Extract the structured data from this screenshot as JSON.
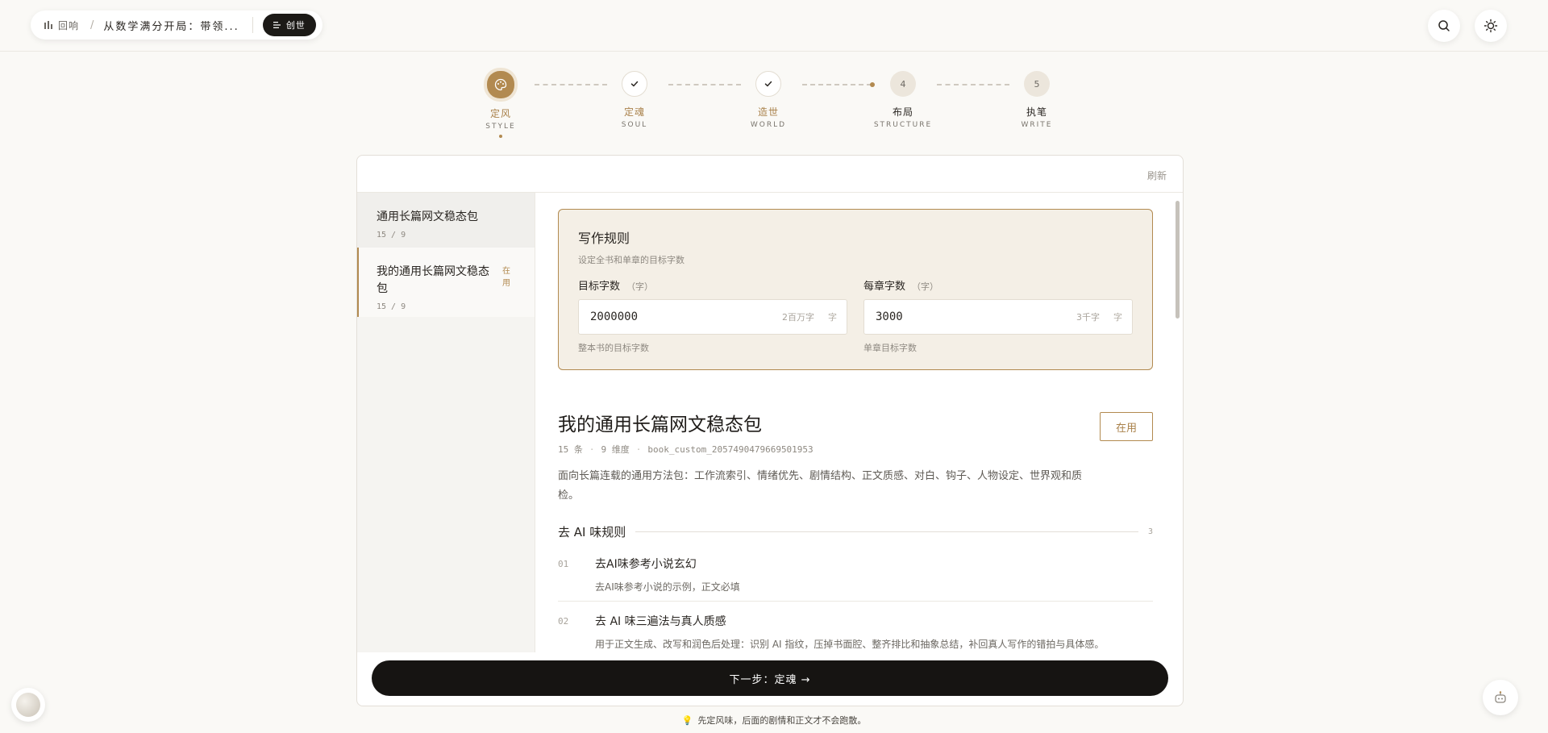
{
  "header": {
    "brand": "回响",
    "separator": "/",
    "book_title": "从数学满分开局：带领...",
    "mode_button": "创世"
  },
  "stepper": {
    "steps": [
      {
        "name": "定风",
        "en": "STYLE",
        "state": "active"
      },
      {
        "name": "定魂",
        "en": "SOUL",
        "state": "done"
      },
      {
        "name": "造世",
        "en": "WORLD",
        "state": "done"
      },
      {
        "name": "布局",
        "en": "STRUCTURE",
        "state": "todo",
        "number": "4"
      },
      {
        "name": "执笔",
        "en": "WRITE",
        "state": "todo",
        "number": "5"
      }
    ]
  },
  "card": {
    "refresh_label": "刷新"
  },
  "sidebar": {
    "packs": [
      {
        "name": "通用长篇网文稳态包",
        "meta": "15 / 9"
      },
      {
        "name": "我的通用长篇网文稳态包",
        "meta": "15 / 9",
        "badge": "在用"
      }
    ]
  },
  "writing_rules": {
    "title": "写作规则",
    "subtitle": "设定全书和单章的目标字数",
    "target_words": {
      "label": "目标字数",
      "unit": "（字）",
      "value": "2000000",
      "hint": "2百万字",
      "suffix": "字",
      "help": "整本书的目标字数"
    },
    "chapter_words": {
      "label": "每章字数",
      "unit": "（字）",
      "value": "3000",
      "hint": "3千字",
      "suffix": "字",
      "help": "单章目标字数"
    }
  },
  "pack_detail": {
    "title": "我的通用长篇网文稳态包",
    "count": "15 条",
    "dimensions": "9 维度",
    "id": "book_custom_2057490479669501953",
    "description": "面向长篇连载的通用方法包：工作流索引、情绪优先、剧情结构、正文质感、对白、钩子、人物设定、世界观和质检。",
    "inuse_label": "在用"
  },
  "section": {
    "title": "去 AI 味规则",
    "count": "3",
    "rules": [
      {
        "no": "01",
        "title": "去AI味参考小说玄幻",
        "desc": "去AI味参考小说的示例，正文必填"
      },
      {
        "no": "02",
        "title": "去 AI 味三遍法与真人质感",
        "desc": "用于正文生成、改写和润色后处理：识别 AI 指纹，压掉书面腔、整齐排比和抽象总结，补回真人写作的错拍与具体感。"
      }
    ]
  },
  "next_button": "下一步：定魂 →",
  "tip": "先定风味，后面的剧情和正文才不会跑散。",
  "colors": {
    "accent": "#b28a50",
    "dark": "#161412",
    "background": "#faf9f6"
  }
}
